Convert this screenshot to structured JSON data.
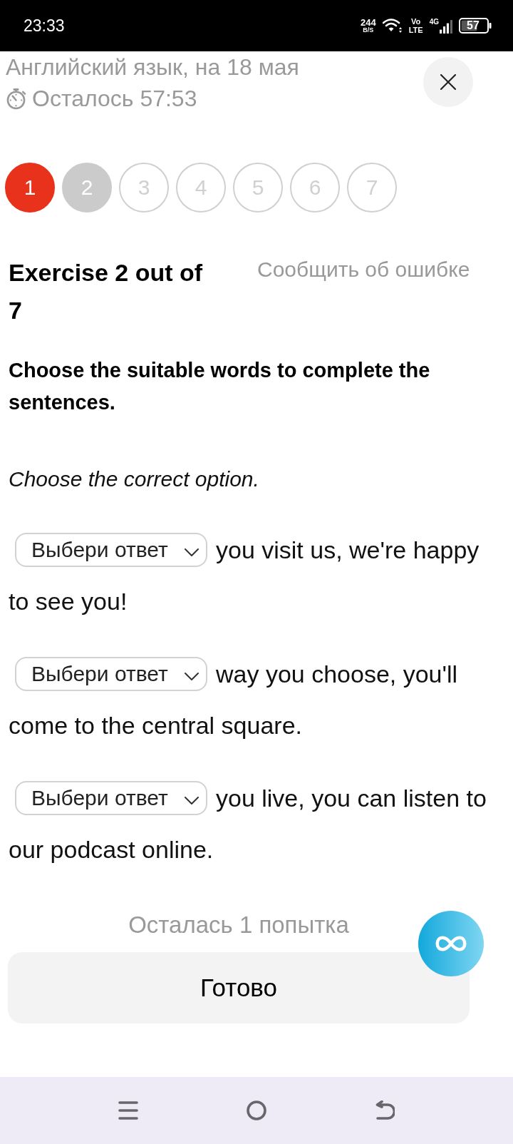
{
  "status_bar": {
    "time": "23:33",
    "speed": "244",
    "speed_unit": "B/S",
    "volte_top": "Vo",
    "volte_bottom": "LTE",
    "network_type": "4G",
    "battery": "57"
  },
  "header": {
    "title": "Английский язык, на 18 мая",
    "timer": "Осталось 57:53"
  },
  "steps": [
    {
      "label": "1",
      "incorrect": true,
      "selected": false
    },
    {
      "label": "2",
      "incorrect": false,
      "selected": true
    },
    {
      "label": "3",
      "incorrect": false,
      "selected": false
    },
    {
      "label": "4",
      "incorrect": false,
      "selected": false
    },
    {
      "label": "5",
      "incorrect": false,
      "selected": false
    },
    {
      "label": "6",
      "incorrect": false,
      "selected": false
    },
    {
      "label": "7",
      "incorrect": false,
      "selected": false
    }
  ],
  "exercise": {
    "title": "Exercise 2 out of 7",
    "report_link": "Сообщить об ошибке",
    "instruction": "Choose the suitable words to complete the sentences.",
    "hint": "Choose the correct option.",
    "sentences": [
      {
        "placeholder": "Выбери ответ",
        "text": "you visit us, we're happy to see you!"
      },
      {
        "placeholder": "Выбери ответ",
        "text": "way you choose, you'll come to the central square."
      },
      {
        "placeholder": "Выбери ответ",
        "text": "you live, you can listen to our podcast online."
      }
    ]
  },
  "attempts_left": "Осталась 1 попытка",
  "submit_button": "Готово"
}
